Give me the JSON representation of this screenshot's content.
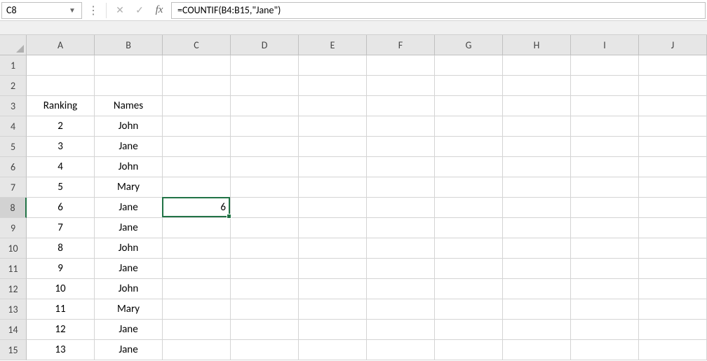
{
  "name_box": {
    "value": "C8"
  },
  "formula_bar": {
    "cancel_icon": "✕",
    "confirm_icon": "✓",
    "fx_label": "fx",
    "formula": "=COUNTIF(B4:B15,\"Jane\")"
  },
  "columns": [
    "A",
    "B",
    "C",
    "D",
    "E",
    "F",
    "G",
    "H",
    "I",
    "J"
  ],
  "row_numbers": [
    1,
    2,
    3,
    4,
    5,
    6,
    7,
    8,
    9,
    10,
    11,
    12,
    13,
    14,
    15
  ],
  "selected_cell": {
    "row": 8,
    "col": "C"
  },
  "selected_value": "6",
  "headers": {
    "ranking": "Ranking",
    "names": "Names"
  },
  "table": [
    {
      "ranking": 2,
      "name": "John"
    },
    {
      "ranking": 3,
      "name": "Jane"
    },
    {
      "ranking": 4,
      "name": "John"
    },
    {
      "ranking": 5,
      "name": "Mary"
    },
    {
      "ranking": 6,
      "name": "Jane"
    },
    {
      "ranking": 7,
      "name": "Jane"
    },
    {
      "ranking": 8,
      "name": "John"
    },
    {
      "ranking": 9,
      "name": "Jane"
    },
    {
      "ranking": 10,
      "name": "John"
    },
    {
      "ranking": 11,
      "name": "Mary"
    },
    {
      "ranking": 12,
      "name": "Jane"
    },
    {
      "ranking": 13,
      "name": "Jane"
    }
  ],
  "chart_data": {
    "type": "table",
    "title": "",
    "columns": [
      "Ranking",
      "Names"
    ],
    "rows": [
      [
        2,
        "John"
      ],
      [
        3,
        "Jane"
      ],
      [
        4,
        "John"
      ],
      [
        5,
        "Mary"
      ],
      [
        6,
        "Jane"
      ],
      [
        7,
        "Jane"
      ],
      [
        8,
        "John"
      ],
      [
        9,
        "Jane"
      ],
      [
        10,
        "John"
      ],
      [
        11,
        "Mary"
      ],
      [
        12,
        "Jane"
      ],
      [
        13,
        "Jane"
      ]
    ],
    "computed": {
      "cell": "C8",
      "formula": "=COUNTIF(B4:B15,\"Jane\")",
      "value": 6
    }
  }
}
